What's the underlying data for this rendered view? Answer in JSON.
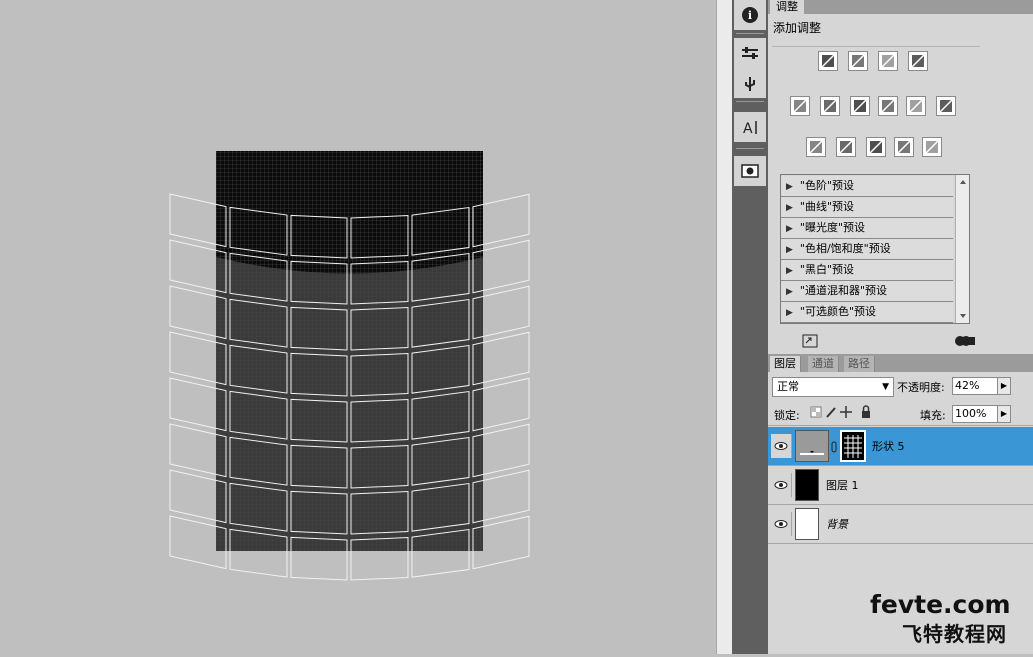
{
  "adjustments": {
    "tab_label": "调整",
    "title": "添加调整",
    "icons": [
      "brightness-contrast-icon",
      "levels-icon",
      "curves-icon",
      "exposure-icon",
      "vibrance-icon",
      "hue-saturation-icon",
      "color-balance-icon",
      "black-white-icon",
      "photo-filter-icon",
      "channel-mixer-icon",
      "invert-icon",
      "posterize-icon",
      "threshold-icon",
      "gradient-map-icon",
      "selective-color-icon"
    ],
    "presets": [
      "\"色阶\"预设",
      "\"曲线\"预设",
      "\"曝光度\"预设",
      "\"色相/饱和度\"预设",
      "\"黑白\"预设",
      "\"通道混和器\"预设",
      "\"可选颜色\"预设"
    ]
  },
  "layers_panel": {
    "tabs": [
      "图层",
      "通道",
      "路径"
    ],
    "blend_mode": "正常",
    "opacity_label": "不透明度:",
    "opacity_value": "42%",
    "lock_label": "锁定:",
    "fill_label": "填充:",
    "fill_value": "100%",
    "layers": [
      {
        "name": "形状 5",
        "selected": true
      },
      {
        "name": "图层 1",
        "selected": false
      },
      {
        "name": "背景",
        "selected": false
      }
    ]
  },
  "watermark": {
    "line1": "fevte.com",
    "line2": "飞特教程网"
  },
  "colors": {
    "selection_blue": "#3a96d5",
    "panel_gray": "#d6d6d6"
  }
}
